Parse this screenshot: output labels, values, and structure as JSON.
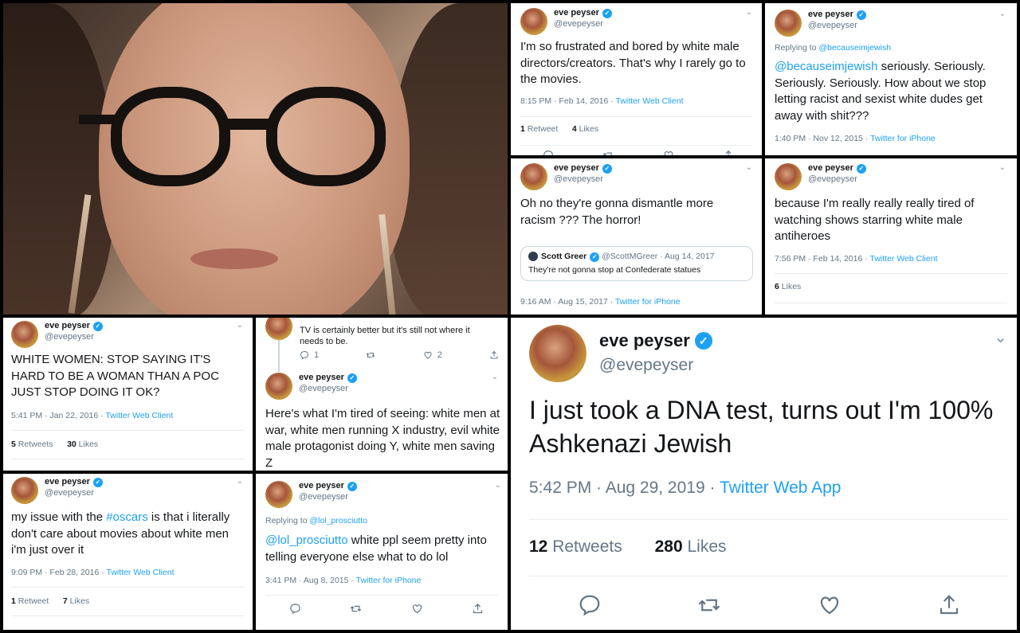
{
  "user": {
    "display_name": "eve peyser",
    "handle": "@evepeyser",
    "verified_mark": "✓"
  },
  "photo": {
    "description_icon": "portrait-photo"
  },
  "tweets": [
    {
      "text": "I'm so frustrated and bored by white male directors/creators. That's why I rarely go to the movies.",
      "time": "8:15 PM · Feb 14, 2016",
      "source": "Twitter Web Client",
      "retweets_num": "1",
      "retweets_label": "Retweet",
      "likes_num": "4",
      "likes_label": "Likes"
    },
    {
      "replying_prefix": "Replying to ",
      "replying_to": "@becauseimjewish",
      "mention": "@becauseimjewish",
      "text": " seriously. Seriously. Seriously. Seriously. How about we stop letting racist and sexist white dudes get away with shit???",
      "time": "1:40 PM · Nov 12, 2015",
      "source": "Twitter for iPhone"
    },
    {
      "text": "Oh no they're gonna dismantle more racism ??? The horror!",
      "quote": {
        "name": "Scott Greer",
        "handle": "@ScottMGreer",
        "date": "· Aug 14, 2017",
        "text": "They're not gonna stop at Confederate statues"
      },
      "time": "9:16 AM · Aug 15, 2017",
      "source": "Twitter for iPhone"
    },
    {
      "text": "because I'm really really really tired of watching shows starring white male antiheroes",
      "time": "7:56 PM · Feb 14, 2016",
      "source": "Twitter Web Client",
      "likes_num": "6",
      "likes_label": "Likes"
    },
    {
      "text": "WHITE WOMEN: STOP SAYING IT'S HARD TO BE A WOMAN THAN A POC JUST STOP DOING IT OK?",
      "time": "5:41 PM · Jan 22, 2016",
      "source": "Twitter Web Client",
      "retweets_num": "5",
      "retweets_label": "Retweets",
      "likes_num": "30",
      "likes_label": "Likes"
    },
    {
      "parent_text": "TV is certainly better but it's still not where it needs to be.",
      "parent_reply_count": "1",
      "parent_like_count": "2",
      "text": "Here's what I'm tired of seeing: white men at war, white men running X industry, evil white male protagonist doing Y, white men saving Z"
    },
    {
      "text_prefix": "my issue with the ",
      "hashtag": "#oscars",
      "text": " is that i literally don't care about movies about white men i'm just over it",
      "time": "9:09 PM · Feb 28, 2016",
      "source": "Twitter Web Client",
      "retweets_num": "1",
      "retweets_label": "Retweet",
      "likes_num": "7",
      "likes_label": "Likes"
    },
    {
      "replying_prefix": "Replying to ",
      "replying_to": "@lol_prosciutto",
      "mention": "@lol_prosciutto",
      "text": " white ppl seem pretty into telling everyone else what to do lol",
      "time": "3:41 PM · Aug 8, 2015",
      "source": "Twitter for iPhone"
    },
    {
      "text": "I just took a DNA test, turns out I'm 100% Ashkenazi Jewish",
      "time": "5:42 PM · Aug 29, 2019 ·",
      "source": "Twitter Web App",
      "retweets_num": "12",
      "retweets_label": "Retweets",
      "likes_num": "280",
      "likes_label": "Likes"
    }
  ],
  "colors": {
    "link": "#1da1f2",
    "muted": "#657786",
    "text": "#14171a"
  }
}
